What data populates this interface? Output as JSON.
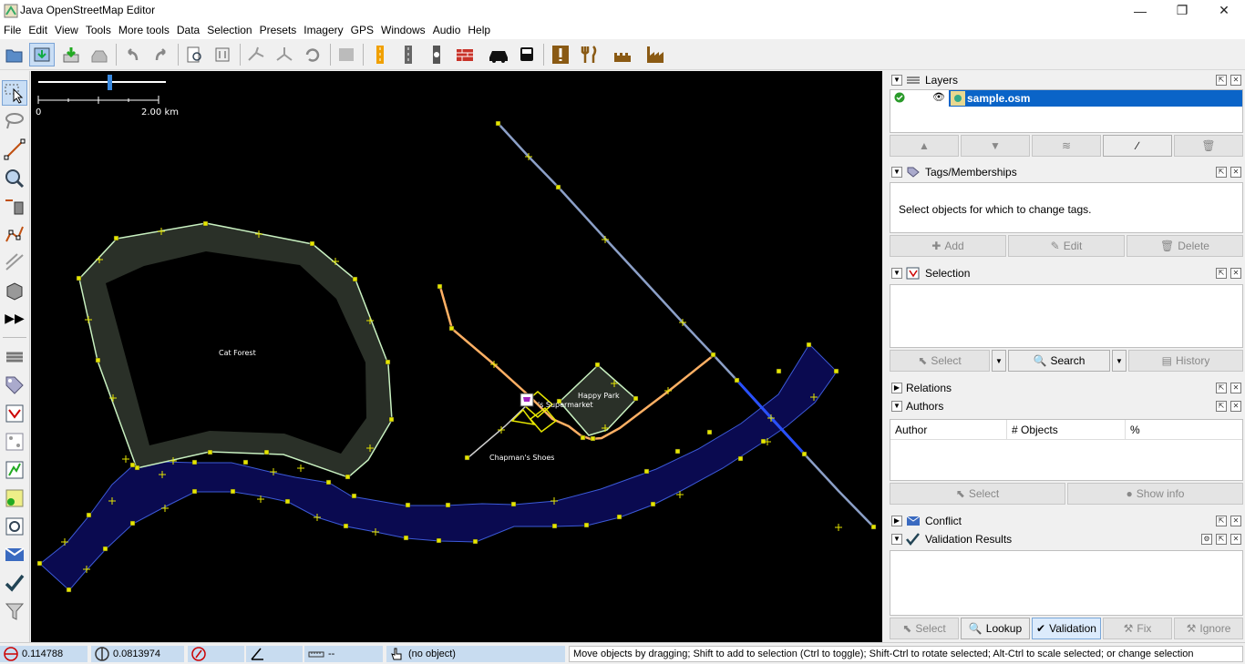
{
  "window": {
    "title": "Java OpenStreetMap Editor"
  },
  "menu": [
    "File",
    "Edit",
    "View",
    "Tools",
    "More tools",
    "Data",
    "Selection",
    "Presets",
    "Imagery",
    "GPS",
    "Windows",
    "Audio",
    "Help"
  ],
  "map": {
    "scale_zero": "0",
    "scale_km": "2.00 km",
    "labels": {
      "cat_forest": "Cat Forest",
      "happy_park": "Happy Park",
      "supermarket": "'s Supermarket",
      "shoes": "Chapman's Shoes"
    }
  },
  "panels": {
    "layers": {
      "title": "Layers",
      "layer_name": "sample.osm"
    },
    "tags": {
      "title": "Tags/Memberships",
      "hint": "Select objects for which to change tags.",
      "add": "Add",
      "edit": "Edit",
      "delete": "Delete"
    },
    "selection": {
      "title": "Selection",
      "select": "Select",
      "search": "Search",
      "history": "History"
    },
    "relations": {
      "title": "Relations"
    },
    "authors": {
      "title": "Authors",
      "col_author": "Author",
      "col_objects": "# Objects",
      "col_percent": "%",
      "select": "Select",
      "show_info": "Show info"
    },
    "conflict": {
      "title": "Conflict"
    },
    "validation": {
      "title": "Validation Results",
      "select": "Select",
      "lookup": "Lookup",
      "validation": "Validation",
      "fix": "Fix",
      "ignore": "Ignore"
    }
  },
  "status": {
    "lat": "0.114788",
    "lon": "0.0813974",
    "angle": "",
    "distance": "--",
    "object": "(no object)",
    "message": "Move objects by dragging; Shift to add to selection (Ctrl to toggle); Shift-Ctrl to rotate selected; Alt-Ctrl to scale selected; or change selection"
  },
  "colors": {
    "map_bg": "#000000",
    "node": "#e6e600",
    "forest_fill": "#2a3028",
    "forest_edge": "#c8f0c0",
    "river": "#0a0a50",
    "river_edge": "#4060e0",
    "railway": "#8ca0c8",
    "road": "#ffb064",
    "selection": "#0a64c8"
  }
}
